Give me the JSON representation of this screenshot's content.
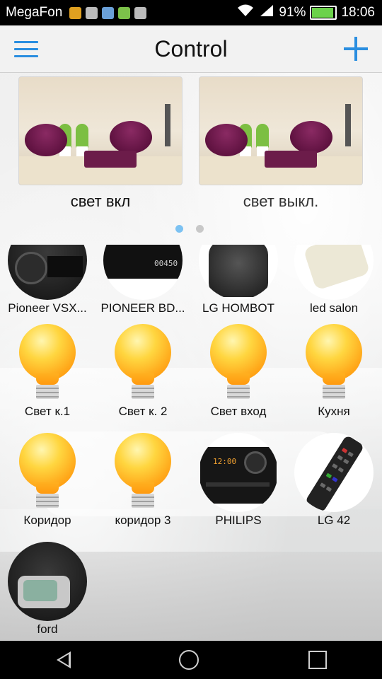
{
  "status_bar": {
    "carrier": "MegaFon",
    "battery": "91%",
    "time": "18:06",
    "notification_icons": [
      "lock-icon",
      "message-icon",
      "vk-icon",
      "play-store-icon",
      "android-icon"
    ]
  },
  "app_bar": {
    "title": "Control",
    "menu_icon": "hamburger-icon",
    "add_icon": "plus-icon",
    "accent_color": "#2a8ee0"
  },
  "scenes": [
    {
      "label": "свет вкл"
    },
    {
      "label": "свет выкл."
    }
  ],
  "pager": {
    "pages": 2,
    "active_index": 0
  },
  "devices": [
    {
      "name": "Pioneer VSX...",
      "kind": "receiver"
    },
    {
      "name": "PIONEER BD...",
      "kind": "bluray",
      "display": "00450"
    },
    {
      "name": "LG HOMBOT",
      "kind": "robot-vacuum"
    },
    {
      "name": "led salon",
      "kind": "remote"
    },
    {
      "name": "Свет к.1",
      "kind": "bulb"
    },
    {
      "name": "Свет к. 2",
      "kind": "bulb"
    },
    {
      "name": "Свет вход",
      "kind": "bulb"
    },
    {
      "name": "Кухня",
      "kind": "bulb"
    },
    {
      "name": "Коридор",
      "kind": "bulb"
    },
    {
      "name": "коридор 3",
      "kind": "bulb"
    },
    {
      "name": "PHILIPS",
      "kind": "stereo"
    },
    {
      "name": "LG 42",
      "kind": "remote"
    },
    {
      "name": "ford",
      "kind": "car-key"
    }
  ]
}
